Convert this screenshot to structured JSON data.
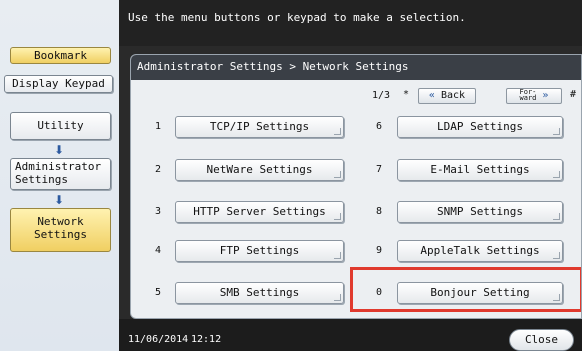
{
  "message": "Use the menu buttons or keypad to make a selection.",
  "left_panel": {
    "bookmark": "Bookmark",
    "display_keypad": "Display Keypad",
    "utility": "Utility",
    "administrator_settings": "Administrator\nSettings",
    "network_settings": "Network\nSettings"
  },
  "breadcrumb": "Administrator Settings > Network Settings",
  "pager": {
    "page": "1/3",
    "star": "*",
    "back_label": "Back",
    "forward_label": "For-\nward",
    "hash": "#"
  },
  "settings": [
    {
      "num": "1",
      "label": "TCP/IP Settings"
    },
    {
      "num": "2",
      "label": "NetWare Settings"
    },
    {
      "num": "3",
      "label": "HTTP Server Settings"
    },
    {
      "num": "4",
      "label": "FTP Settings"
    },
    {
      "num": "5",
      "label": "SMB Settings"
    },
    {
      "num": "6",
      "label": "LDAP Settings"
    },
    {
      "num": "7",
      "label": "E-Mail Settings"
    },
    {
      "num": "8",
      "label": "SNMP Settings"
    },
    {
      "num": "9",
      "label": "AppleTalk Settings"
    },
    {
      "num": "0",
      "label": "Bonjour Setting"
    }
  ],
  "footer": {
    "date": "11/06/2014",
    "time": "12:12",
    "close": "Close"
  },
  "colors": {
    "highlight": "#e03a2e",
    "active_yellow": "#f0cf62",
    "dark_bar": "#222222"
  }
}
